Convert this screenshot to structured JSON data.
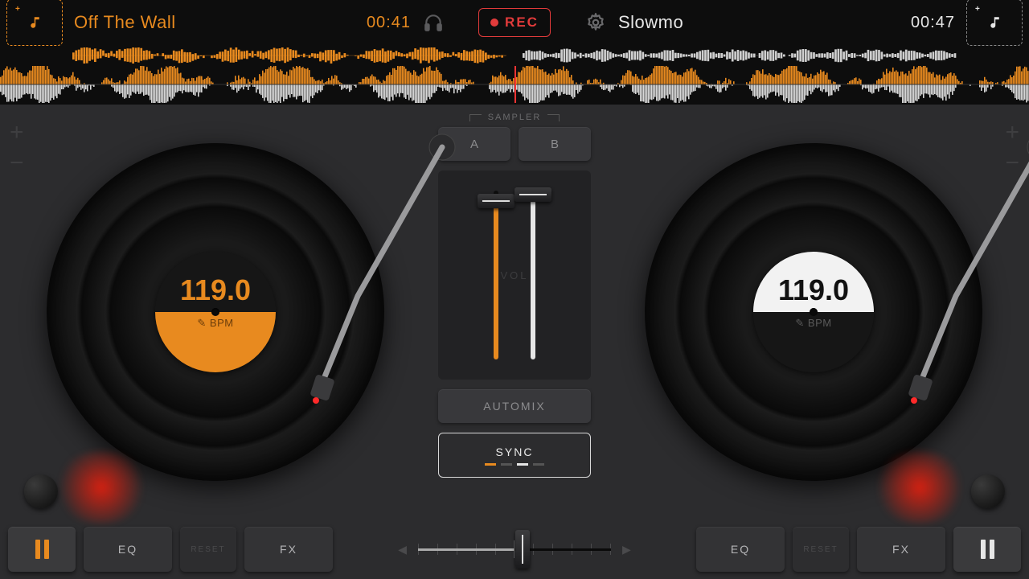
{
  "deckA": {
    "title": "Off The Wall",
    "time": "00:41",
    "bpm": "119.0",
    "bpm_label": "✎ BPM"
  },
  "deckB": {
    "title": "Slowmo",
    "time": "00:47",
    "bpm": "119.0",
    "bpm_label": "✎ BPM"
  },
  "header": {
    "rec": "REC"
  },
  "sampler": {
    "label": "SAMPLER",
    "a": "A",
    "b": "B",
    "vol": "VOL"
  },
  "center": {
    "automix": "AUTOMIX",
    "sync": "SYNC"
  },
  "bottom": {
    "eq": "EQ",
    "reset": "RESET",
    "fx": "FX"
  },
  "colors": {
    "accentA": "#e88a1f",
    "accentB": "#e6e6e6",
    "rec": "#e23b3b"
  }
}
